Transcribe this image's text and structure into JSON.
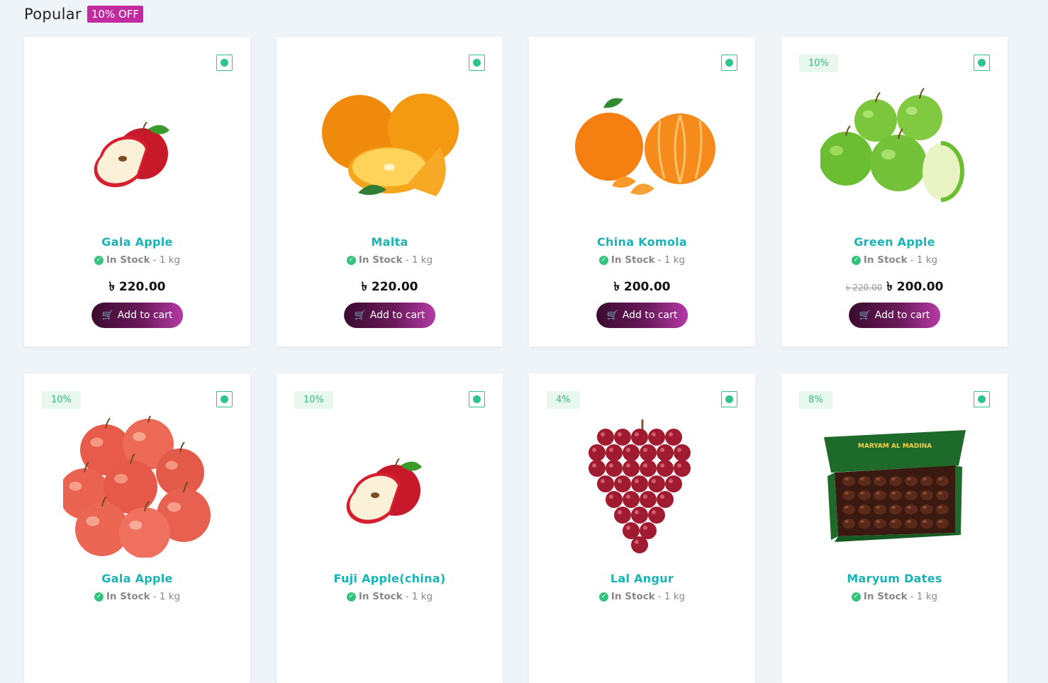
{
  "section": {
    "title": "Popular",
    "badge": "10% OFF"
  },
  "currency": "৳",
  "products": [
    {
      "name": "Gala Apple",
      "stock": "In Stock",
      "unit": "- 1 kg",
      "price": "220.00",
      "old_price": "",
      "discount": "",
      "image": "single-apple"
    },
    {
      "name": "Malta",
      "stock": "In Stock",
      "unit": "- 1 kg",
      "price": "220.00",
      "old_price": "",
      "discount": "",
      "image": "oranges"
    },
    {
      "name": "China Komola",
      "stock": "In Stock",
      "unit": "- 1 kg",
      "price": "200.00",
      "old_price": "",
      "discount": "",
      "image": "mandarin"
    },
    {
      "name": "Green Apple",
      "stock": "In Stock",
      "unit": "- 1 kg",
      "price": "200.00",
      "old_price": "220.00",
      "discount": "10%",
      "image": "green-apples"
    },
    {
      "name": "Gala Apple",
      "stock": "In Stock",
      "unit": "- 1 kg",
      "price": "",
      "old_price": "",
      "discount": "10%",
      "image": "apple-pile"
    },
    {
      "name": "Fuji Apple(china)",
      "stock": "In Stock",
      "unit": "- 1 kg",
      "price": "",
      "old_price": "",
      "discount": "10%",
      "image": "single-apple"
    },
    {
      "name": "Lal Angur",
      "stock": "In Stock",
      "unit": "- 1 kg",
      "price": "",
      "old_price": "",
      "discount": "4%",
      "image": "grapes"
    },
    {
      "name": "Maryum Dates",
      "stock": "In Stock",
      "unit": "- 1 kg",
      "price": "",
      "old_price": "",
      "discount": "8%",
      "image": "dates-box"
    }
  ],
  "add_to_cart_label": "Add to cart",
  "dates_box_text": "MARYAM AL MADINA",
  "colors": {
    "accent": "#19b3b6",
    "badge": "#c42aa0",
    "stock": "#35c27d",
    "veg": "#2fc48a"
  }
}
